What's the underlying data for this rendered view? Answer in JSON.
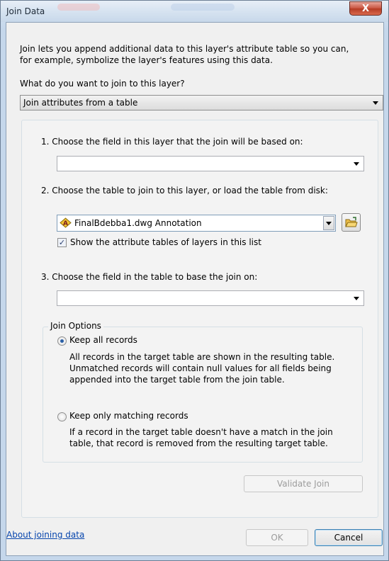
{
  "window": {
    "title": "Join Data",
    "close_label": "X"
  },
  "intro": {
    "line1": "Join lets you append additional data to this layer's attribute table so you can,",
    "line2": "for example, symbolize the layer's features using this data."
  },
  "join_type": {
    "question": "What do you want to join to this layer?",
    "selected": "Join attributes from a table"
  },
  "step1": {
    "label": "1.  Choose the field in this layer that the join will be based on:",
    "value": ""
  },
  "step2": {
    "label": "2.  Choose the table to join to this layer, or load the table from disk:",
    "value": "FinalBdebba1.dwg Annotation",
    "show_checkbox_label": "Show the attribute tables of layers in this list",
    "show_checked": true
  },
  "step3": {
    "label": "3.  Choose the field in the table to base the join on:",
    "value": ""
  },
  "join_options": {
    "legend": "Join Options",
    "keep_all": {
      "label": "Keep all records",
      "selected": true,
      "desc1": "All records in the target table are shown in the resulting table.",
      "desc2": "Unmatched records will contain null values for all fields being",
      "desc3": "appended into the target table from the join table."
    },
    "keep_matching": {
      "label": "Keep only matching records",
      "selected": false,
      "desc1": "If a record in the target table doesn't have a match in the join",
      "desc2": "table, that record is removed from the resulting target table."
    }
  },
  "buttons": {
    "validate": "Validate Join",
    "ok": "OK",
    "cancel": "Cancel"
  },
  "help_link": "About joining data",
  "icons": {
    "layer": "annotation-layer-icon",
    "browse": "open-folder-icon"
  }
}
